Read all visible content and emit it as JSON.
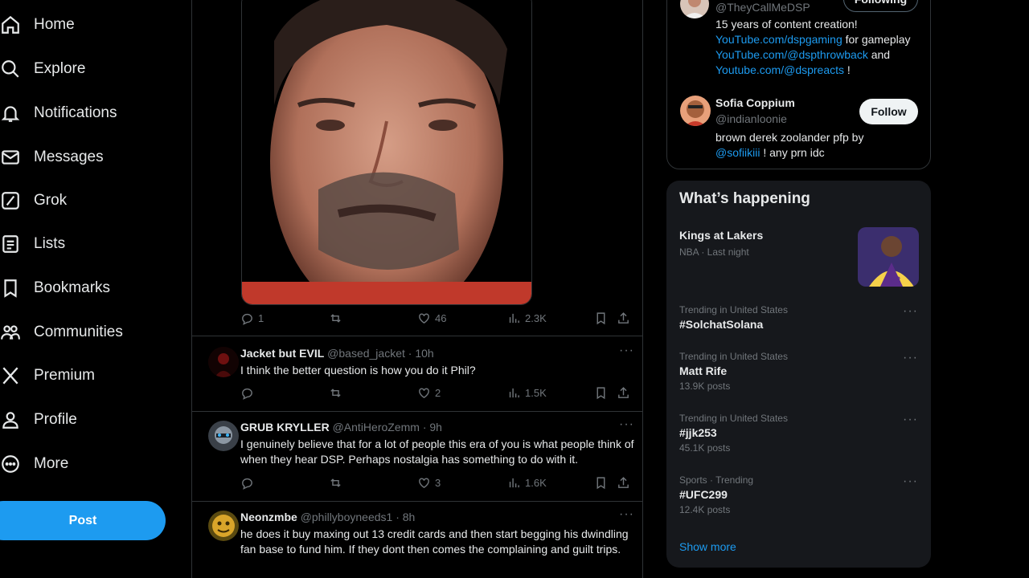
{
  "nav": {
    "items": [
      {
        "label": "Home",
        "icon": "home-icon"
      },
      {
        "label": "Explore",
        "icon": "search-icon"
      },
      {
        "label": "Notifications",
        "icon": "bell-icon"
      },
      {
        "label": "Messages",
        "icon": "envelope-icon"
      },
      {
        "label": "Grok",
        "icon": "grok-icon"
      },
      {
        "label": "Lists",
        "icon": "list-icon"
      },
      {
        "label": "Bookmarks",
        "icon": "bookmark-icon"
      },
      {
        "label": "Communities",
        "icon": "people-icon"
      },
      {
        "label": "Premium",
        "icon": "x-logo-icon"
      },
      {
        "label": "Profile",
        "icon": "person-icon"
      },
      {
        "label": "More",
        "icon": "more-circle-icon"
      }
    ],
    "post_label": "Post"
  },
  "main_post": {
    "stats": {
      "replies": "1",
      "likes": "46",
      "views": "2.3K"
    }
  },
  "replies": [
    {
      "name": "Jacket but EVIL",
      "handle": "@based_jacket",
      "time": "10h",
      "text": "I think the better question is how you do it Phil?",
      "replies": "",
      "likes": "2",
      "views": "1.5K"
    },
    {
      "name": "GRUB KRYLLER",
      "handle": "@AntiHeroZemm",
      "time": "9h",
      "text": "I genuinely believe that for a lot of people this era of you is what people think of when they hear DSP. Perhaps nostalgia has something to do with it.",
      "replies": "",
      "likes": "3",
      "views": "1.6K"
    },
    {
      "name": "Neonzmbe",
      "handle": "@phillyboyneeds1",
      "time": "8h",
      "text": "he does it buy maxing out 13 credit cards and then start begging his dwindling fan base to fund him. If they dont  then comes the complaining and guilt trips."
    }
  ],
  "who_to_follow": {
    "first": {
      "handle": "@TheyCallMeDSP",
      "button": "Following",
      "bio_line1": "15 years of content creation!",
      "link1": "YouTube.com/dspgaming",
      "link1_suffix": " for gameplay",
      "link2": "YouTube.com/@dspthrowback",
      "link2_suffix": " and",
      "link3": "Youtube.com/@dspreacts",
      "link3_suffix": " !"
    },
    "second": {
      "name": "Sofia Coppium",
      "handle": "@indianloonie",
      "button": "Follow",
      "bio_prefix": "brown derek zoolander pfp by",
      "mention": "@sofiikiii",
      "bio_suffix": " ! any prn idc"
    }
  },
  "whats_happening": {
    "title": "What’s happening",
    "featured": {
      "title": "Kings at Lakers",
      "meta": "NBA · Last night"
    },
    "trends": [
      {
        "label": "Trending in United States",
        "title": "#SolchatSolana",
        "count": ""
      },
      {
        "label": "Trending in United States",
        "title": "Matt Rife",
        "count": "13.9K posts"
      },
      {
        "label": "Trending in United States",
        "title": "#jjk253",
        "count": "45.1K posts"
      },
      {
        "label": "Sports · Trending",
        "title": "#UFC299",
        "count": "12.4K posts"
      }
    ],
    "show_more": "Show more"
  },
  "colors": {
    "accent": "#1d9bf0",
    "background": "#000000",
    "muted": "#71767b"
  }
}
